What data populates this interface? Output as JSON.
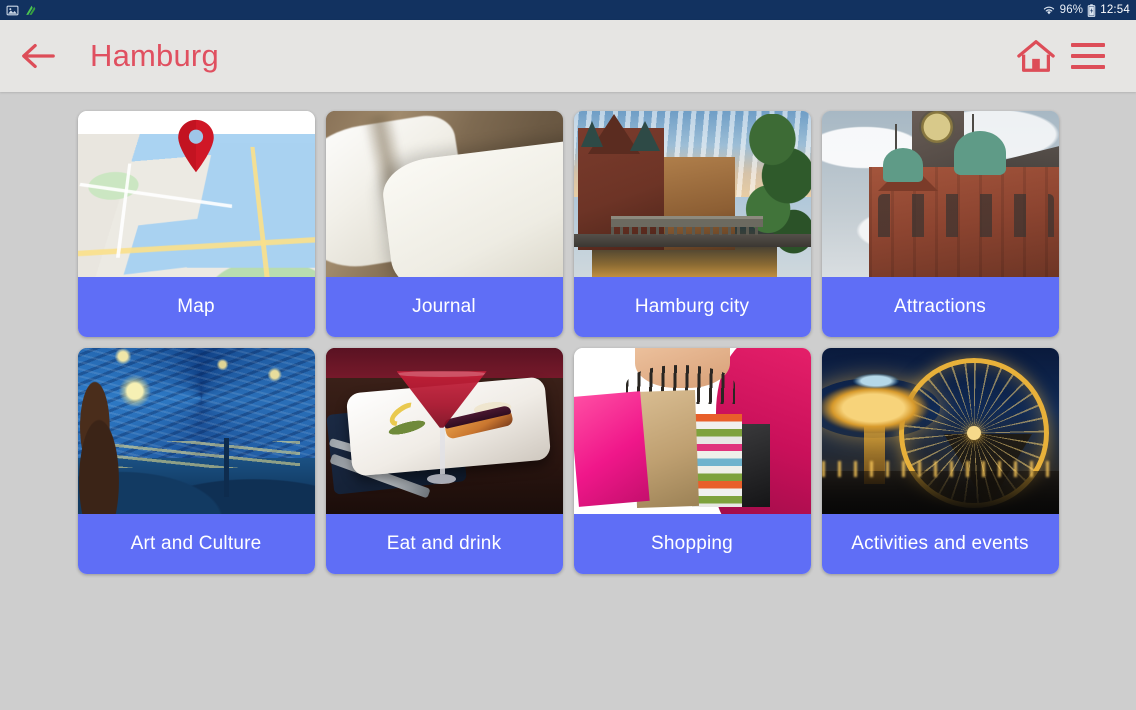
{
  "status_bar": {
    "left_icons": [
      {
        "name": "screenshot-notification-icon",
        "glyph": "image"
      },
      {
        "name": "app-notification-icon",
        "glyph": "green-mark"
      }
    ],
    "wifi_icon": "wifi-icon",
    "battery_percent": "96%",
    "battery_icon": "battery-icon",
    "clock": "12:54",
    "background": "#123260"
  },
  "app_bar": {
    "back_label": "back-arrow",
    "title": "Hamburg",
    "home_label": "home-icon",
    "menu_label": "menu-icon",
    "accent_color": "#dd4d58",
    "background": "#e6e5e3"
  },
  "grid": {
    "label_color": "#5f6ef6",
    "label_text_color": "#ffffff",
    "cards": [
      {
        "id": "map",
        "label": "Map",
        "image": "map-with-location-pin"
      },
      {
        "id": "journal",
        "label": "Journal",
        "image": "open-blank-notebook-on-desk"
      },
      {
        "id": "hamburg-city",
        "label": "Hamburg city",
        "image": "speicherstadt-canal-at-dusk"
      },
      {
        "id": "attractions",
        "label": "Attractions",
        "image": "historic-brick-tower-with-green-domes"
      },
      {
        "id": "art-and-culture",
        "label": "Art and Culture",
        "image": "van-gogh-starry-night-painting"
      },
      {
        "id": "eat-and-drink",
        "label": "Eat and drink",
        "image": "plated-salmon-with-red-cocktail"
      },
      {
        "id": "shopping",
        "label": "Shopping",
        "image": "hand-holding-colorful-shopping-bags"
      },
      {
        "id": "activities-and-events",
        "label": "Activities and events",
        "image": "funfair-ferris-wheel-at-night"
      }
    ]
  },
  "page_background": "#cecece"
}
